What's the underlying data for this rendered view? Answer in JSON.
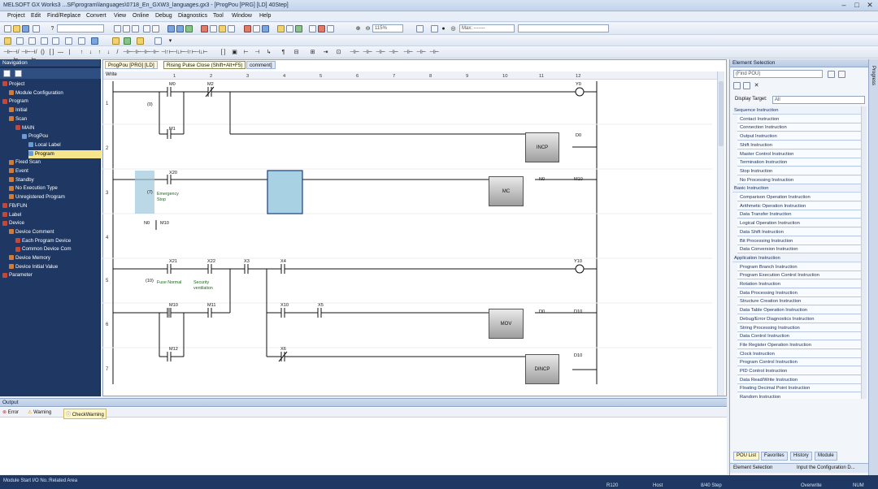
{
  "window": {
    "title": "MELSOFT GX Works3 ...SF\\program\\languages\\0718_En_GXW3_languages.gx3 - [ProgPou [PRG] [LD] 40Step]"
  },
  "menu": [
    "Project",
    "Edit",
    "Find/Replace",
    "Convert",
    "View",
    "Online",
    "Debug",
    "Diagnostics",
    "Tool",
    "Window",
    "Help"
  ],
  "toolbar": {
    "zoom": "115%",
    "search_placeholder": "Max: -------"
  },
  "editor": {
    "tab_label": "ProgPou [PRG] [LD]",
    "tooltip": "Rising Pulse Close (Shift+Alt+F5)",
    "tab_suffix": "comment]",
    "write_label": "Write",
    "columns": [
      "1",
      "2",
      "3",
      "4",
      "5",
      "6",
      "7",
      "8",
      "9",
      "10",
      "11",
      "12"
    ],
    "rows": [
      "1",
      "2",
      "3",
      "4",
      "5",
      "6",
      "7"
    ],
    "step_numbers": [
      "(0)",
      "(7)",
      "(10)"
    ],
    "devices": {
      "m0": "M0",
      "m2": "M2",
      "y0": "Y0",
      "m1": "M1",
      "d0": "D0",
      "x20": "X20",
      "n0a": "N0",
      "m10a": "M10",
      "n0b": "N0",
      "m10b": "M10",
      "x21": "X21",
      "x22": "X22",
      "x3": "X3",
      "x4": "X4",
      "y10": "Y10",
      "m10c": "M10",
      "m11": "M11",
      "x10": "X10",
      "x5": "X5",
      "d0b": "D0",
      "d10a": "D10",
      "m12": "M12",
      "x6": "X6",
      "d10b": "D10"
    },
    "comments": {
      "emergency": "Emergency Stop",
      "fuse": "Fuse Normal",
      "security": "Security ventilation"
    },
    "instructions": {
      "incp": "INCP",
      "mc": "MC",
      "mov": "MOV",
      "dincp": "DINCP"
    }
  },
  "navigation": {
    "title": "Navigation",
    "items": [
      {
        "label": "Project",
        "level": 0
      },
      {
        "label": "Module Configuration",
        "level": 1
      },
      {
        "label": "Program",
        "level": 0
      },
      {
        "label": "Initial",
        "level": 1
      },
      {
        "label": "Scan",
        "level": 1
      },
      {
        "label": "MAIN",
        "level": 2
      },
      {
        "label": "ProgPou",
        "level": 3
      },
      {
        "label": "Local Label",
        "level": 4
      },
      {
        "label": "Program",
        "level": 4,
        "selected": true
      },
      {
        "label": "Fixed Scan",
        "level": 1
      },
      {
        "label": "Event",
        "level": 1
      },
      {
        "label": "Standby",
        "level": 1
      },
      {
        "label": "No Execution Type",
        "level": 1
      },
      {
        "label": "Unregistered Program",
        "level": 1
      },
      {
        "label": "FB/FUN",
        "level": 0
      },
      {
        "label": "Label",
        "level": 0
      },
      {
        "label": "Device",
        "level": 0
      },
      {
        "label": "Device Comment",
        "level": 1
      },
      {
        "label": "Each Program Device",
        "level": 2
      },
      {
        "label": "Common Device Com",
        "level": 2
      },
      {
        "label": "Device Memory",
        "level": 1
      },
      {
        "label": "Device Initial Value",
        "level": 1
      },
      {
        "label": "Parameter",
        "level": 0
      }
    ]
  },
  "element_selection": {
    "title": "Element Selection",
    "search_placeholder": "(Find POU)",
    "display_target_label": "Display Target:",
    "display_target_value": "All",
    "list": [
      {
        "t": "cat",
        "label": "Sequence Instruction"
      },
      {
        "t": "ins",
        "label": "Contact Instruction"
      },
      {
        "t": "ins",
        "label": "Connection Instruction"
      },
      {
        "t": "ins",
        "label": "Output Instruction"
      },
      {
        "t": "ins",
        "label": "Shift Instruction"
      },
      {
        "t": "ins",
        "label": "Master Control Instruction"
      },
      {
        "t": "ins",
        "label": "Termination Instruction"
      },
      {
        "t": "ins",
        "label": "Stop Instruction"
      },
      {
        "t": "ins",
        "label": "No Processing Instruction"
      },
      {
        "t": "cat",
        "label": "Basic Instruction"
      },
      {
        "t": "ins",
        "label": "Comparison Operation Instruction"
      },
      {
        "t": "ins",
        "label": "Arithmetic Operation Instruction"
      },
      {
        "t": "ins",
        "label": "Data Transfer Instruction"
      },
      {
        "t": "ins",
        "label": "Logical Operation Instruction"
      },
      {
        "t": "ins",
        "label": "Data Shift Instruction"
      },
      {
        "t": "ins",
        "label": "Bit Processing Instruction"
      },
      {
        "t": "ins",
        "label": "Data Conversion Instruction"
      },
      {
        "t": "cat",
        "label": "Application Instruction"
      },
      {
        "t": "ins",
        "label": "Program Branch Instruction"
      },
      {
        "t": "ins",
        "label": "Program Execution Control Instruction"
      },
      {
        "t": "ins",
        "label": "Rotation Instruction"
      },
      {
        "t": "ins",
        "label": "Data Processing Instruction"
      },
      {
        "t": "ins",
        "label": "Structure Creation Instruction"
      },
      {
        "t": "ins",
        "label": "Data Table Operation Instruction"
      },
      {
        "t": "ins",
        "label": "Debug/Error Diagnostics Instruction"
      },
      {
        "t": "ins",
        "label": "String Processing Instruction"
      },
      {
        "t": "ins",
        "label": "Data Control Instruction"
      },
      {
        "t": "ins",
        "label": "File Register Operation Instruction"
      },
      {
        "t": "ins",
        "label": "Clock Instruction"
      },
      {
        "t": "ins",
        "label": "Program Control Instruction"
      },
      {
        "t": "ins",
        "label": "PID Control Instruction"
      },
      {
        "t": "ins",
        "label": "Data Read/Write Instruction"
      },
      {
        "t": "ins",
        "label": "Floating Decimal Point Instruction"
      },
      {
        "t": "ins",
        "label": "Random Instruction"
      }
    ],
    "tabs": [
      "POU List",
      "Favorites",
      "History",
      "Module"
    ],
    "bottom_tabs": [
      "Element Selection",
      "Input the Configuration D..."
    ]
  },
  "output": {
    "title": "Output",
    "tabs": [
      "Error",
      "Warning",
      "CheckWarning"
    ]
  },
  "statusbar": {
    "left": "Module Start I/O No.:Related Area",
    "items": [
      "R120",
      "Host",
      "8/40 Step",
      "Overwrite",
      "NUM"
    ]
  },
  "right_strip_label": "Progress"
}
